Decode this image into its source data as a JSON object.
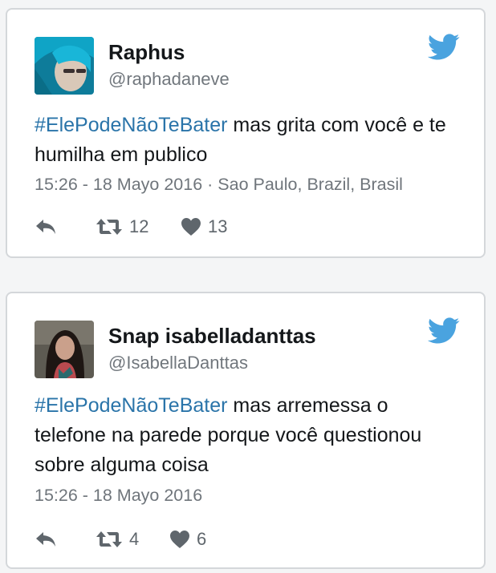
{
  "tweets": [
    {
      "name": "Raphus",
      "handle": "@raphadaneve",
      "hashtag": "#ElePodeNãoTeBater",
      "text_rest": " mas grita com você e te humilha em publico",
      "meta": "15:26 - 18 Mayo 2016 · Sao Paulo, Brazil, Brasil",
      "retweets": "12",
      "likes": "13"
    },
    {
      "name": "Snap isabelladanttas",
      "handle": "@IsabellaDanttas",
      "hashtag": "#ElePodeNãoTeBater",
      "text_rest": " mas arremessa o telefone na parede porque você questionou sobre alguma coisa",
      "meta": "15:26 - 18 Mayo 2016",
      "retweets": "4",
      "likes": "6"
    }
  ],
  "icons": {
    "brand": "twitter-bird-icon",
    "reply": "reply-arrow-icon",
    "retweet": "retweet-icon",
    "like": "heart-icon"
  },
  "colors": {
    "hashtag": "#2a74a9",
    "brand": "#4aa3df",
    "text": "#14171a",
    "muted": "#71777d"
  }
}
